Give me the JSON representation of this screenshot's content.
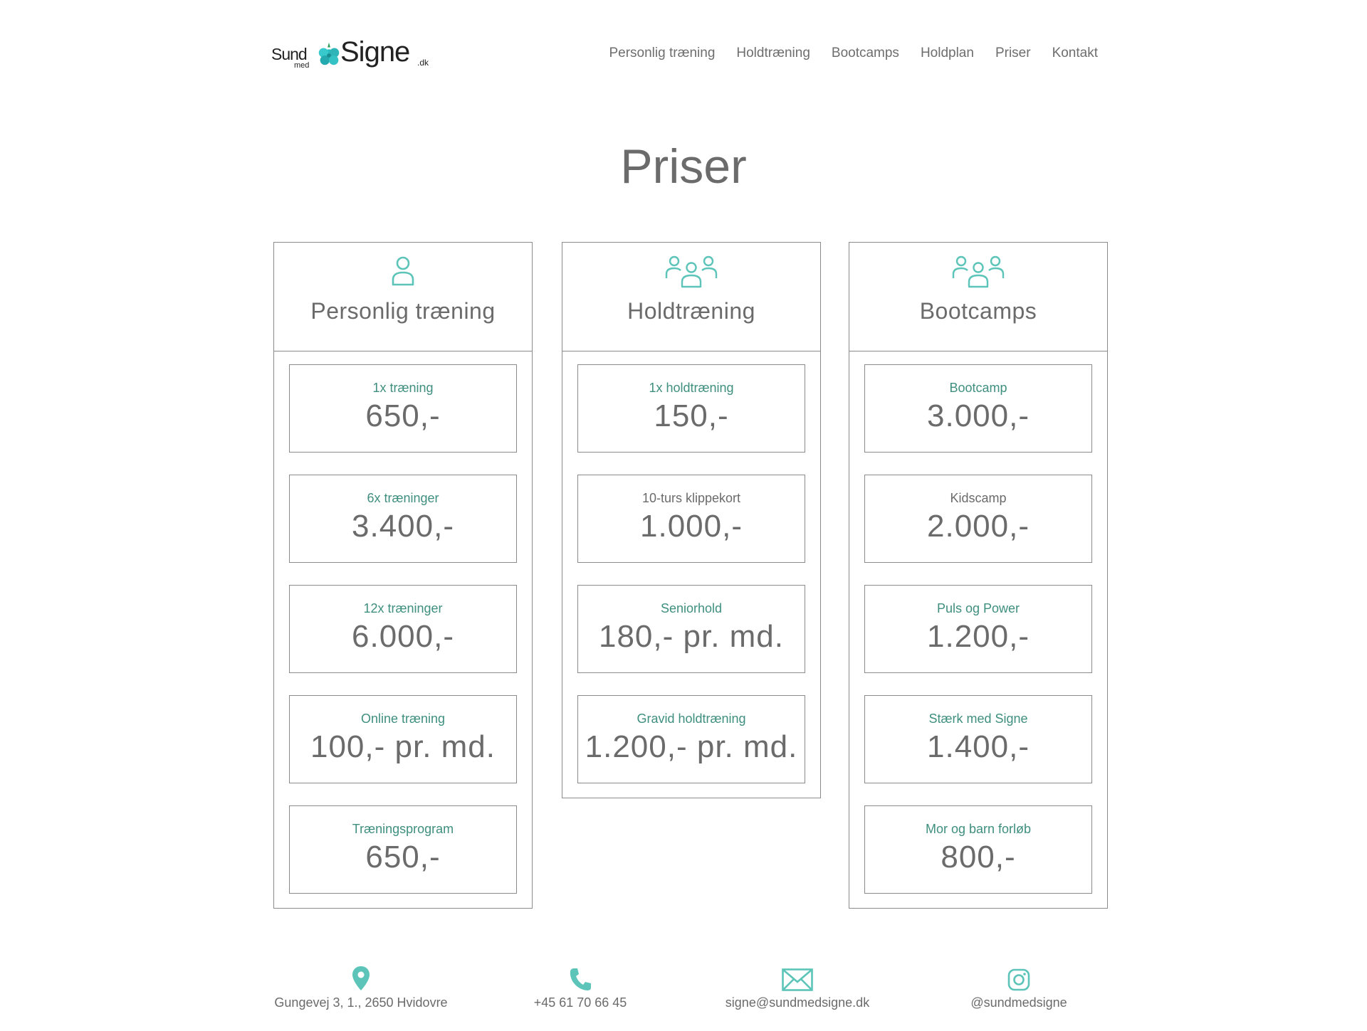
{
  "header": {
    "logo": {
      "part_a": "Sund",
      "part_med": "med",
      "part_b": "Signe",
      "part_dk": ".dk"
    },
    "nav": [
      "Personlig træning",
      "Holdtræning",
      "Bootcamps",
      "Holdplan",
      "Priser",
      "Kontakt"
    ]
  },
  "page_title": "Priser",
  "columns": [
    {
      "title": "Personlig træning",
      "icon": "person-icon",
      "cards": [
        {
          "label": "1x træning",
          "price": "650,-"
        },
        {
          "label": "6x træninger",
          "price": "3.400,-"
        },
        {
          "label": "12x træninger",
          "price": "6.000,-"
        },
        {
          "label": "Online træning",
          "price": "100,- pr. md."
        },
        {
          "label": "Træningsprogram",
          "price": "650,-"
        }
      ]
    },
    {
      "title": "Holdtræning",
      "icon": "group-icon",
      "cards": [
        {
          "label": "1x holdtræning",
          "price": "150,-"
        },
        {
          "label": "10-turs klippekort",
          "price": "1.000,-"
        },
        {
          "label": "Seniorhold",
          "price": "180,- pr. md."
        },
        {
          "label": "Gravid holdtræning",
          "price": "1.200,- pr. md."
        }
      ]
    },
    {
      "title": "Bootcamps",
      "icon": "group-icon",
      "cards": [
        {
          "label": "Bootcamp",
          "price": "3.000,-"
        },
        {
          "label": "Kidscamp",
          "price": "2.000,-"
        },
        {
          "label": "Puls og Power",
          "price": "1.200,-"
        },
        {
          "label": "Stærk med Signe",
          "price": "1.400,-"
        },
        {
          "label": "Mor og barn forløb",
          "price": "800,-"
        }
      ]
    }
  ],
  "footer": {
    "address": "Gungevej 3, 1., 2650 Hvidovre",
    "phone": "+45 61 70 66 45",
    "email": "signe@sundmedsigne.dk",
    "instagram": "@sundmedsigne"
  },
  "colors": {
    "accent": "#5cc4b8",
    "text": "#6b6b6b",
    "label": "#3f8f7f",
    "border": "#8a8a8a"
  }
}
